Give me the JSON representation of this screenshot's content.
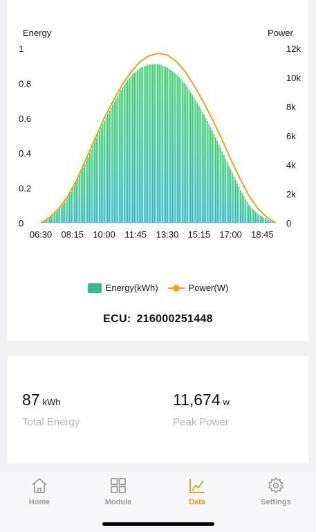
{
  "chart_data": {
    "type": "bar",
    "left_axis_label": "Energy",
    "right_axis_label": "Power",
    "left_ticks": [
      "0",
      "0.2",
      "0.4",
      "0.6",
      "0.8",
      "1"
    ],
    "right_ticks": [
      "0",
      "2k",
      "4k",
      "6k",
      "8k",
      "10k",
      "12k"
    ],
    "ylim_left": [
      0,
      1
    ],
    "ylim_right": [
      0,
      12000
    ],
    "x_ticks": [
      "06:30",
      "08:15",
      "10:00",
      "11:45",
      "13:30",
      "15:15",
      "17:00",
      "18:45"
    ],
    "series": [
      {
        "name": "Energy(kWh)",
        "axis": "left",
        "color_top": "#3ecf6e",
        "color_bottom": "#2ab4c4",
        "x": [
          "06:30",
          "07:00",
          "07:30",
          "08:00",
          "08:30",
          "09:00",
          "09:30",
          "10:00",
          "10:30",
          "11:00",
          "11:30",
          "12:00",
          "12:30",
          "13:00",
          "13:30",
          "14:00",
          "14:30",
          "15:00",
          "15:30",
          "16:00",
          "16:30",
          "17:00",
          "17:30",
          "18:00",
          "18:30",
          "19:00",
          "19:30"
        ],
        "values": [
          0.0,
          0.03,
          0.08,
          0.15,
          0.25,
          0.36,
          0.48,
          0.59,
          0.69,
          0.78,
          0.85,
          0.89,
          0.91,
          0.91,
          0.89,
          0.85,
          0.79,
          0.71,
          0.62,
          0.52,
          0.41,
          0.3,
          0.19,
          0.1,
          0.05,
          0.02,
          0.0
        ]
      },
      {
        "name": "Power(W)",
        "axis": "right",
        "color": "#e8a21c",
        "x": [
          "06:30",
          "07:00",
          "07:30",
          "08:00",
          "08:30",
          "09:00",
          "09:30",
          "10:00",
          "10:30",
          "11:00",
          "11:30",
          "12:00",
          "12:30",
          "13:00",
          "13:30",
          "14:00",
          "14:30",
          "15:00",
          "15:30",
          "16:00",
          "16:30",
          "17:00",
          "17:30",
          "18:00",
          "18:30",
          "19:00",
          "19:30"
        ],
        "values": [
          0,
          400,
          1000,
          1850,
          3000,
          4400,
          5800,
          7200,
          8400,
          9500,
          10400,
          11100,
          11500,
          11670,
          11550,
          11100,
          10400,
          9400,
          8300,
          7100,
          5800,
          4400,
          3100,
          1900,
          1000,
          400,
          0
        ]
      }
    ],
    "legend": [
      "Energy(kWh)",
      "Power(W)"
    ],
    "legend_position": "bottom"
  },
  "ecu": {
    "label": "ECU:",
    "id": "216000251448"
  },
  "summary": {
    "energy_value": "87",
    "energy_unit": "kWh",
    "energy_label": "Total Energy",
    "power_value": "11,674",
    "power_unit": "w",
    "power_label": "Peak Power"
  },
  "tabs": [
    {
      "label": "Home",
      "icon": "home-icon",
      "active": false
    },
    {
      "label": "Module",
      "icon": "grid-icon",
      "active": false
    },
    {
      "label": "Data",
      "icon": "chart-icon",
      "active": true
    },
    {
      "label": "Settings",
      "icon": "gear-icon",
      "active": false
    }
  ],
  "colors": {
    "accent": "#e89a16",
    "energy_green": "#3ecf6e",
    "energy_teal": "#2ab4c4",
    "power_line": "#e8a21c",
    "inactive_tab": "#9a9a9a"
  }
}
